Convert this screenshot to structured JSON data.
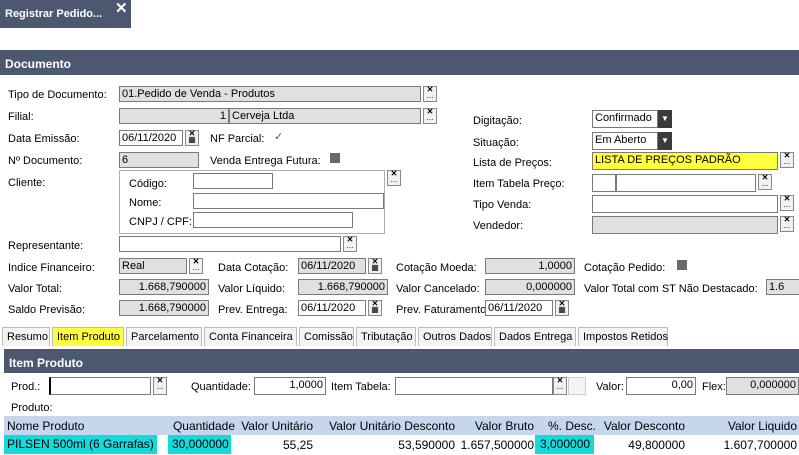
{
  "window": {
    "title": "Registrar Pedido...",
    "close": "✕"
  },
  "documento": {
    "header": "Documento",
    "tipo_documento": {
      "label": "Tipo de Documento:",
      "value": "01.Pedido de Venda - Produtos"
    },
    "filial": {
      "label": "Filial:",
      "code": "1",
      "value": "Cerveja Ltda"
    },
    "data_emissao": {
      "label": "Data Emissão:",
      "value": "06/11/2020"
    },
    "nf_parcial": {
      "label": "NF Parcial:",
      "check": "✓"
    },
    "n_documento": {
      "label": "Nº Documento:",
      "value": "6"
    },
    "venda_entrega_futura": {
      "label": "Venda Entrega Futura:"
    },
    "cliente": {
      "label": "Cliente:",
      "codigo_label": "Código:",
      "nome_label": "Nome:",
      "cnpj_label": "CNPJ / CPF:"
    },
    "representante": {
      "label": "Representante:"
    },
    "digitacao": {
      "label": "Digitação:",
      "value": "Confirmado"
    },
    "situacao": {
      "label": "Situação:",
      "value": "Em Aberto"
    },
    "lista_precos": {
      "label": "Lista de Preços:",
      "value": "LISTA DE PREÇOS PADRÃO"
    },
    "item_tabela_preco": {
      "label": "Item Tabela Preço:"
    },
    "tipo_venda": {
      "label": "Tipo Venda:"
    },
    "vendedor": {
      "label": "Vendedor:"
    },
    "indice_financeiro": {
      "label": "Indice Financeiro:",
      "value": "Real"
    },
    "data_cotacao": {
      "label": "Data Cotação:",
      "value": "06/11/2020"
    },
    "cotacao_moeda": {
      "label": "Cotação Moeda:",
      "value": "1,0000"
    },
    "cotacao_pedido": {
      "label": "Cotação Pedido:"
    },
    "valor_total": {
      "label": "Valor Total:",
      "value": "1.668,790000"
    },
    "valor_liquido": {
      "label": "Valor Líquido:",
      "value": "1.668,790000"
    },
    "valor_cancelado": {
      "label": "Valor Cancelado:",
      "value": "0,000000"
    },
    "valor_total_st": {
      "label": "Valor Total com ST Não Destacado:",
      "value": "1.6"
    },
    "saldo_previsao": {
      "label": "Saldo Previsão:",
      "value": "1.668,790000"
    },
    "prev_entrega": {
      "label": "Prev. Entrega:",
      "value": "06/11/2020"
    },
    "prev_faturamento": {
      "label": "Prev. Faturamento:",
      "value": "06/11/2020"
    }
  },
  "tabs": [
    "Resumo",
    "Item Produto",
    "Parcelamento",
    "Conta Financeira",
    "Comissão",
    "Tributação",
    "Outros Dados",
    "Dados Entrega",
    "Impostos Retidos"
  ],
  "item_produto": {
    "header": "Item Produto",
    "prod_label": "Prod.:",
    "quantidade_label": "Quantidade:",
    "quantidade_value": "1,0000",
    "item_tabela_label": "Item Tabela:",
    "valor_label": "Valor:",
    "valor_value": "0,00",
    "flex_label": "Flex:",
    "flex_value": "0,000000",
    "produto_label": "Produto:"
  },
  "grid": {
    "columns": [
      "Nome Produto",
      "Quantidade",
      "Valor Unitário",
      "Valor Unitário Desconto",
      "Valor Bruto",
      "%. Desc.",
      "Valor Desconto",
      "Valor Liquido"
    ],
    "rows": [
      [
        "PILSEN 500ml (6 Garrafas)",
        "30,000000",
        "55,25",
        "53,590000",
        "1.657,500000",
        "3,000000",
        "49,800000",
        "1.607,700000"
      ]
    ]
  },
  "colors": {
    "header_bg": "#4c5870",
    "highlight_yellow": "#ffff3c",
    "highlight_cyan": "#14dada",
    "grid_header": "#c6d6ec"
  },
  "icons": {
    "lookup": "clear-search-icon",
    "calendar": "calendar-icon",
    "dropdown": "chevron-down-icon"
  }
}
